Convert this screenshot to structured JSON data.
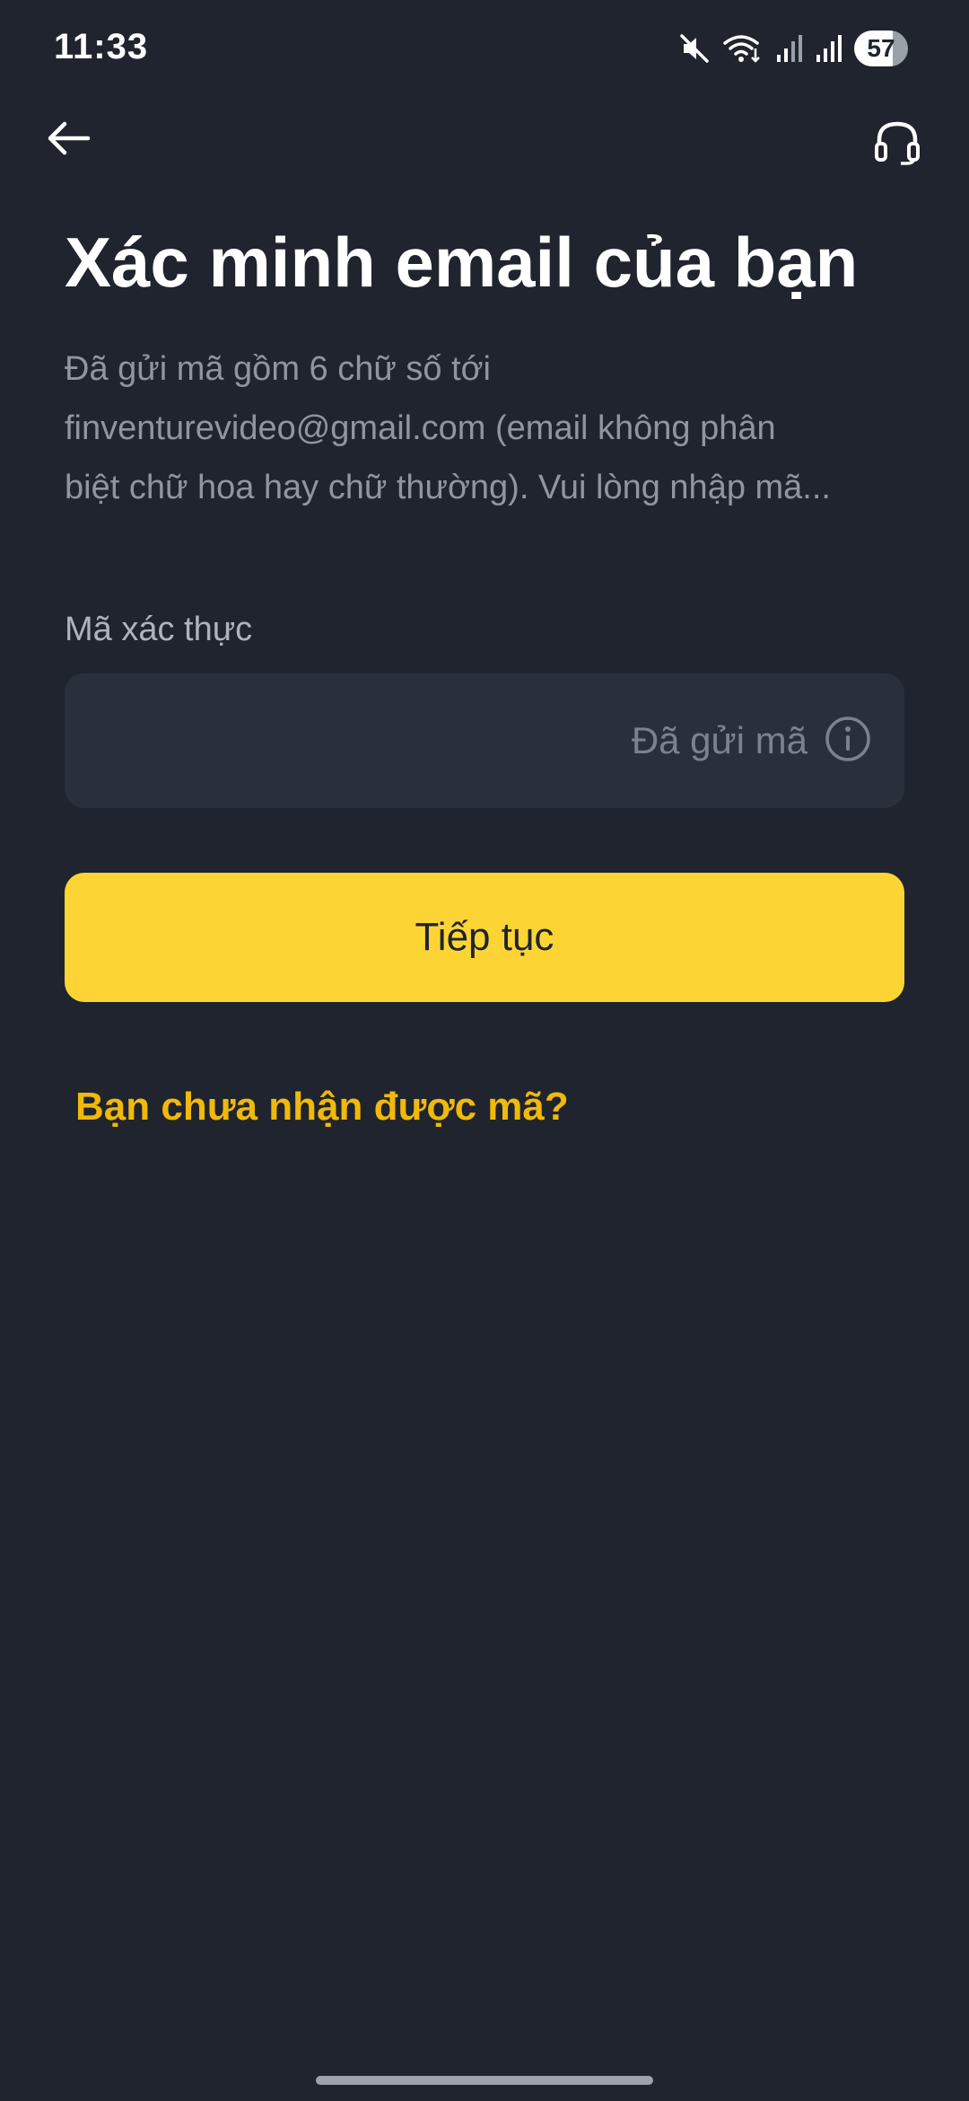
{
  "status_bar": {
    "time": "11:33",
    "battery": "57",
    "icons": [
      "mute-icon",
      "wifi-icon",
      "signal-icon",
      "signal-icon"
    ]
  },
  "header": {
    "back_icon": "arrow-left-icon",
    "support_icon": "headset-icon"
  },
  "title": "Xác minh email của bạn",
  "description": {
    "line1": "Đã gửi mã gồm 6 chữ số tới",
    "line2": "finventurevideo@gmail.com (email không phân",
    "line3": "biệt chữ hoa hay chữ thường). Vui lòng nhập mã..."
  },
  "code_field": {
    "label": "Mã xác thực",
    "value": "",
    "status_text": "Đã gửi mã",
    "status_icon": "info-icon"
  },
  "continue_button": {
    "label": "Tiếp tục"
  },
  "resend_link": {
    "label": "Bạn chưa nhận được mã?"
  },
  "colors": {
    "background": "#1f242e",
    "field_background": "#2a303b",
    "primary_button": "#fcd535",
    "link": "#f0b90b",
    "muted_text": "#8f95a1"
  }
}
